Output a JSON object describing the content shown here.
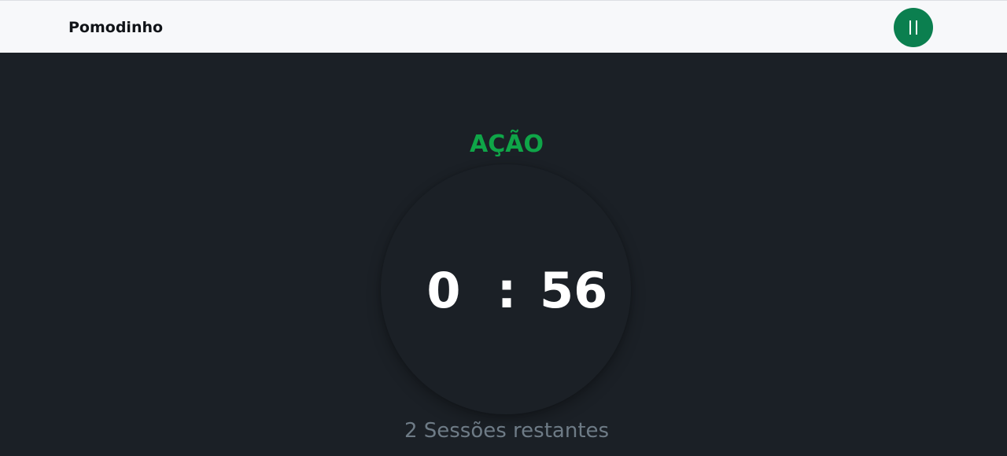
{
  "header": {
    "brand": "Pomodinho",
    "pause_button": {
      "icon": "pause-icon",
      "color": "#0b7f4f"
    }
  },
  "timer": {
    "mode": "AÇÃO",
    "mode_color": "#0fa548",
    "minutes": "0",
    "separator": ":",
    "seconds": "56"
  },
  "sessions": {
    "text": "2 Sessões restantes"
  },
  "colors": {
    "background": "#1b2026",
    "header_bg": "#f7f8fa",
    "sessions_text": "#6e7b86"
  }
}
